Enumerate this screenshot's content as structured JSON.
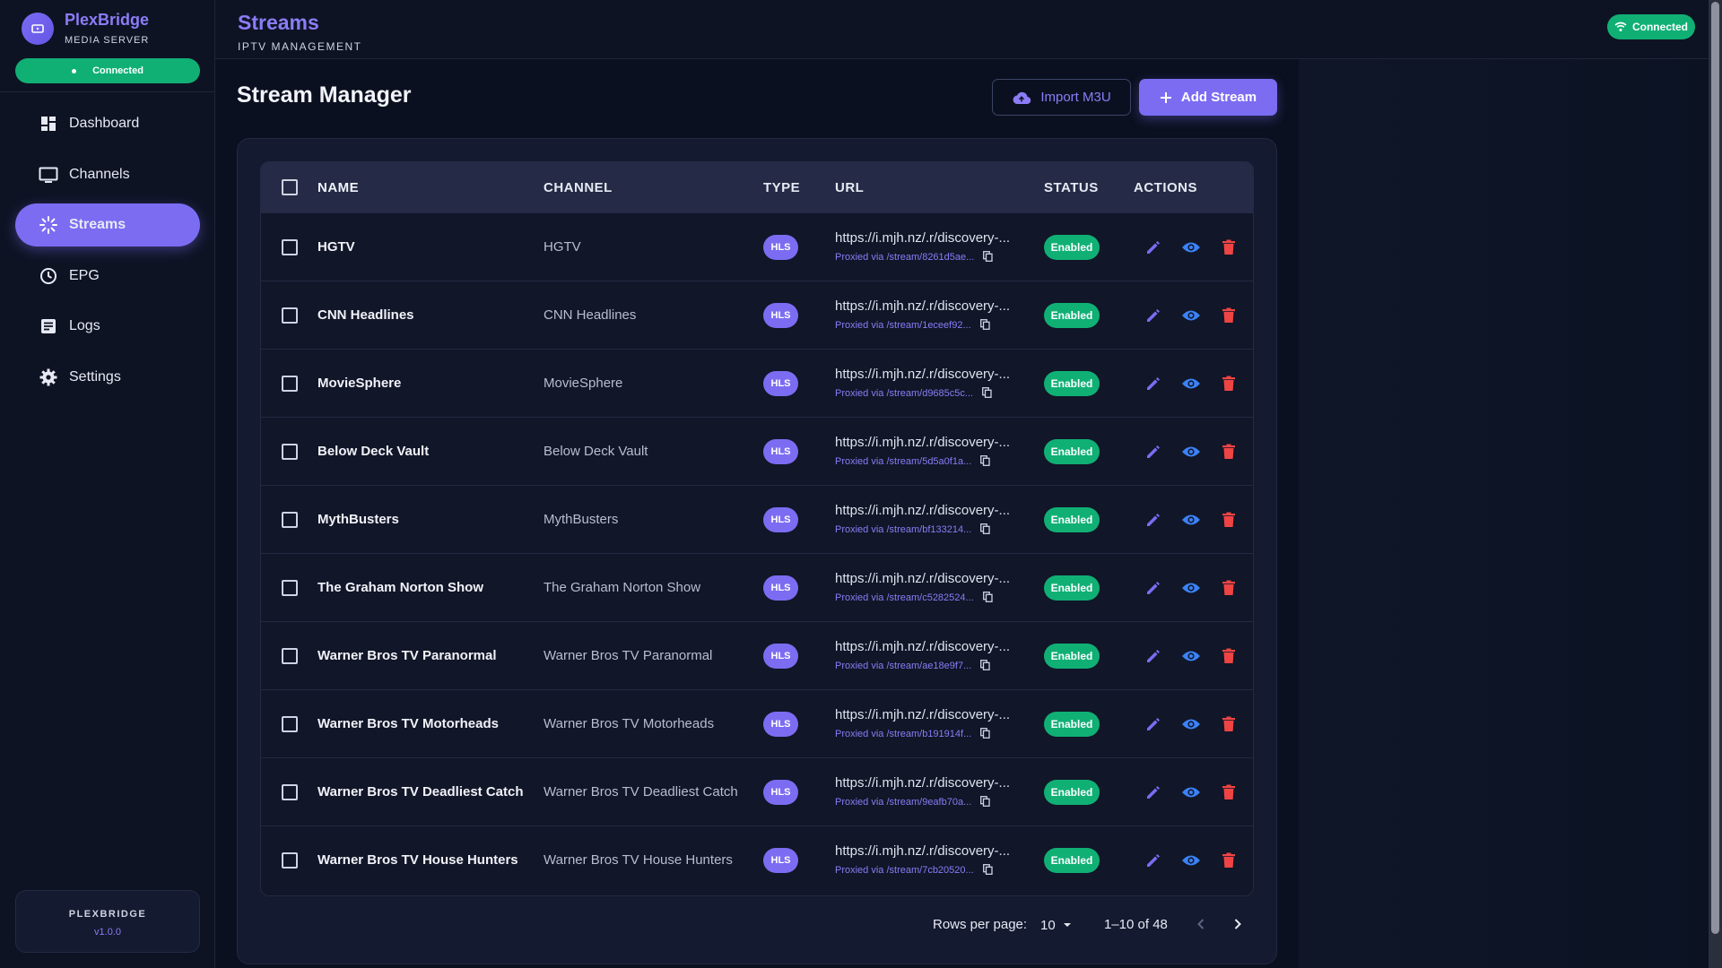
{
  "app": {
    "name": "PlexBridge",
    "subtitle": "MEDIA SERVER",
    "connection": "Connected"
  },
  "sidebar": {
    "items": [
      {
        "label": "Dashboard",
        "icon": "dashboard-icon"
      },
      {
        "label": "Channels",
        "icon": "tv-icon"
      },
      {
        "label": "Streams",
        "icon": "streams-icon",
        "active": true
      },
      {
        "label": "EPG",
        "icon": "clock-icon"
      },
      {
        "label": "Logs",
        "icon": "logs-icon"
      },
      {
        "label": "Settings",
        "icon": "gear-icon"
      }
    ],
    "version_name": "PLEXBRIDGE",
    "version": "v1.0.0"
  },
  "header": {
    "title": "Streams",
    "subtitle": "IPTV MANAGEMENT",
    "status": "Connected"
  },
  "main": {
    "title": "Stream Manager",
    "import_label": "Import M3U",
    "add_label": "Add Stream"
  },
  "table": {
    "columns": {
      "name": "NAME",
      "channel": "CHANNEL",
      "type": "TYPE",
      "url": "URL",
      "status": "STATUS",
      "actions": "ACTIONS"
    },
    "rows": [
      {
        "name": "HGTV",
        "channel": "HGTV",
        "type": "HLS",
        "url": "https://i.mjh.nz/.r/discovery-...",
        "proxy": "Proxied via /stream/8261d5ae...",
        "status": "Enabled"
      },
      {
        "name": "CNN Headlines",
        "channel": "CNN Headlines",
        "type": "HLS",
        "url": "https://i.mjh.nz/.r/discovery-...",
        "proxy": "Proxied via /stream/1eceef92...",
        "status": "Enabled"
      },
      {
        "name": "MovieSphere",
        "channel": "MovieSphere",
        "type": "HLS",
        "url": "https://i.mjh.nz/.r/discovery-...",
        "proxy": "Proxied via /stream/d9685c5c...",
        "status": "Enabled"
      },
      {
        "name": "Below Deck Vault",
        "channel": "Below Deck Vault",
        "type": "HLS",
        "url": "https://i.mjh.nz/.r/discovery-...",
        "proxy": "Proxied via /stream/5d5a0f1a...",
        "status": "Enabled"
      },
      {
        "name": "MythBusters",
        "channel": "MythBusters",
        "type": "HLS",
        "url": "https://i.mjh.nz/.r/discovery-...",
        "proxy": "Proxied via /stream/bf133214...",
        "status": "Enabled"
      },
      {
        "name": "The Graham Norton Show",
        "channel": "The Graham Norton Show",
        "type": "HLS",
        "url": "https://i.mjh.nz/.r/discovery-...",
        "proxy": "Proxied via /stream/c5282524...",
        "status": "Enabled"
      },
      {
        "name": "Warner Bros TV Paranormal",
        "channel": "Warner Bros TV Paranormal",
        "type": "HLS",
        "url": "https://i.mjh.nz/.r/discovery-...",
        "proxy": "Proxied via /stream/ae18e9f7...",
        "status": "Enabled"
      },
      {
        "name": "Warner Bros TV Motorheads",
        "channel": "Warner Bros TV Motorheads",
        "type": "HLS",
        "url": "https://i.mjh.nz/.r/discovery-...",
        "proxy": "Proxied via /stream/b191914f...",
        "status": "Enabled"
      },
      {
        "name": "Warner Bros TV Deadliest Catch",
        "channel": "Warner Bros TV Deadliest Catch",
        "type": "HLS",
        "url": "https://i.mjh.nz/.r/discovery-...",
        "proxy": "Proxied via /stream/9eafb70a...",
        "status": "Enabled"
      },
      {
        "name": "Warner Bros TV House Hunters",
        "channel": "Warner Bros TV House Hunters",
        "type": "HLS",
        "url": "https://i.mjh.nz/.r/discovery-...",
        "proxy": "Proxied via /stream/7cb20520...",
        "status": "Enabled"
      }
    ]
  },
  "pagination": {
    "rows_per_page_label": "Rows per page:",
    "rows_per_page": "10",
    "range": "1–10 of 48"
  },
  "colors": {
    "accent": "#7c6cf2",
    "success": "#10b075",
    "danger": "#ef4444",
    "view": "#3b82f6"
  }
}
